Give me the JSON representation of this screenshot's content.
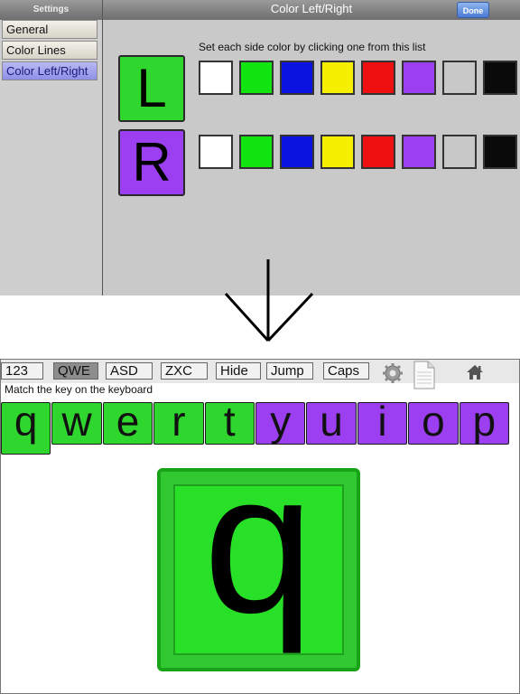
{
  "settings": {
    "sidebar_title": "Settings",
    "items": [
      "General",
      "Color Lines",
      "Color Left/Right"
    ],
    "selected_item": "Color Left/Right",
    "panel_title": "Color Left/Right",
    "done_label": "Done",
    "instruction": "Set each side color by clicking one from this list",
    "left_label": "L",
    "right_label": "R",
    "left_color": "#2ed62e",
    "right_color": "#9b3ff0",
    "swatch_colors": [
      "#ffffff",
      "#11e411",
      "#0b13e0",
      "#f7ef00",
      "#ee1010",
      "#9b3ff0",
      "#c8c8c8",
      "#0a0a0a"
    ]
  },
  "app": {
    "toolbar": [
      "123",
      "QWE",
      "ASD",
      "ZXC",
      "Hide",
      "Jump",
      "Caps"
    ],
    "selected_tab": "QWE",
    "icons": [
      "gear-icon",
      "document-icon",
      "home-icon"
    ],
    "prompt": "Match the key on the keyboard",
    "keys": [
      {
        "letter": "q",
        "side": "left"
      },
      {
        "letter": "w",
        "side": "left"
      },
      {
        "letter": "e",
        "side": "left"
      },
      {
        "letter": "r",
        "side": "left"
      },
      {
        "letter": "t",
        "side": "left"
      },
      {
        "letter": "y",
        "side": "right"
      },
      {
        "letter": "u",
        "side": "right"
      },
      {
        "letter": "i",
        "side": "right"
      },
      {
        "letter": "o",
        "side": "right"
      },
      {
        "letter": "p",
        "side": "right"
      }
    ],
    "key_colors": {
      "left": "#2ed62e",
      "right": "#9b3ff0"
    },
    "big_letter": "q",
    "big_color": "#27e027"
  }
}
